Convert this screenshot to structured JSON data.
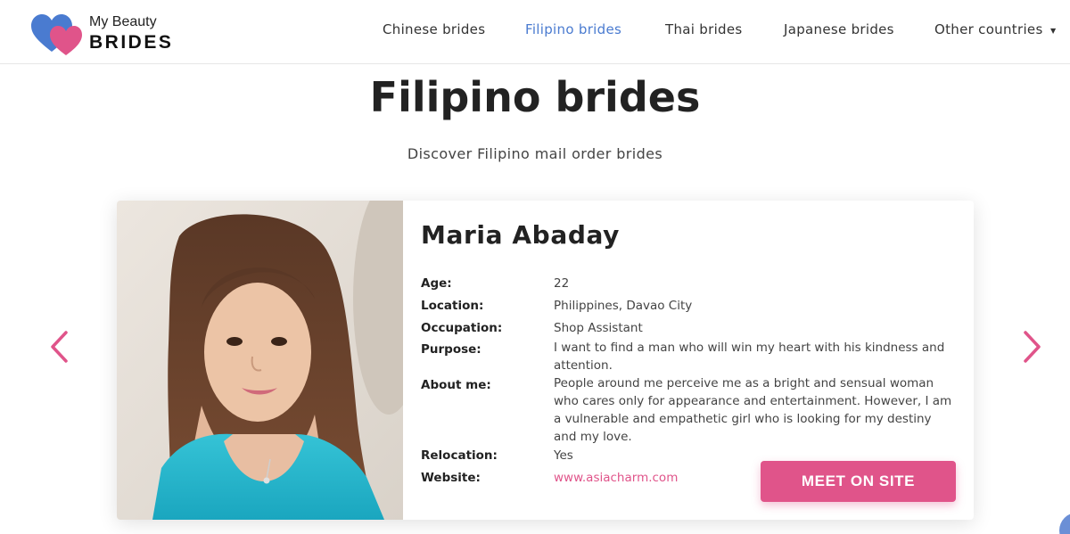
{
  "brand": {
    "top_text": "My Beauty",
    "bottom_text": "BRIDES",
    "colors": {
      "heart_blue": "#4a7bd0",
      "heart_pink": "#e0548a"
    }
  },
  "nav": {
    "items": [
      {
        "label": "Chinese brides",
        "active": false
      },
      {
        "label": "Filipino brides",
        "active": true
      },
      {
        "label": "Thai brides",
        "active": false
      },
      {
        "label": "Japanese brides",
        "active": false
      },
      {
        "label": "Other countries",
        "active": false
      }
    ],
    "dropdown_icon": "caret-down-icon",
    "active_color": "#4a7bd0"
  },
  "page": {
    "title": "Filipino brides",
    "subtitle": "Discover Filipino mail order brides"
  },
  "carousel": {
    "prev_icon": "chevron-left-icon",
    "next_icon": "chevron-right-icon",
    "arrow_color": "#e0548a"
  },
  "profile": {
    "name": "Maria Abaday",
    "fields": [
      {
        "label": "Age:",
        "value": "22"
      },
      {
        "label": "Location:",
        "value": "Philippines, Davao City"
      },
      {
        "label": "Occupation:",
        "value": "Shop Assistant"
      },
      {
        "label": "Purpose:",
        "value": "I want to find a man who will win my heart with his kindness and attention."
      },
      {
        "label": "About me:",
        "value": "People around me perceive me as a bright and sensual woman who cares only for appearance and entertainment. However, I am a vulnerable and empathetic girl who is looking for my destiny and my love."
      },
      {
        "label": "Relocation:",
        "value": "Yes"
      },
      {
        "label": "Website:",
        "value": "www.asiacharm.com"
      }
    ],
    "cta_label": "MEET ON SITE",
    "cta_color": "#e0548a"
  }
}
